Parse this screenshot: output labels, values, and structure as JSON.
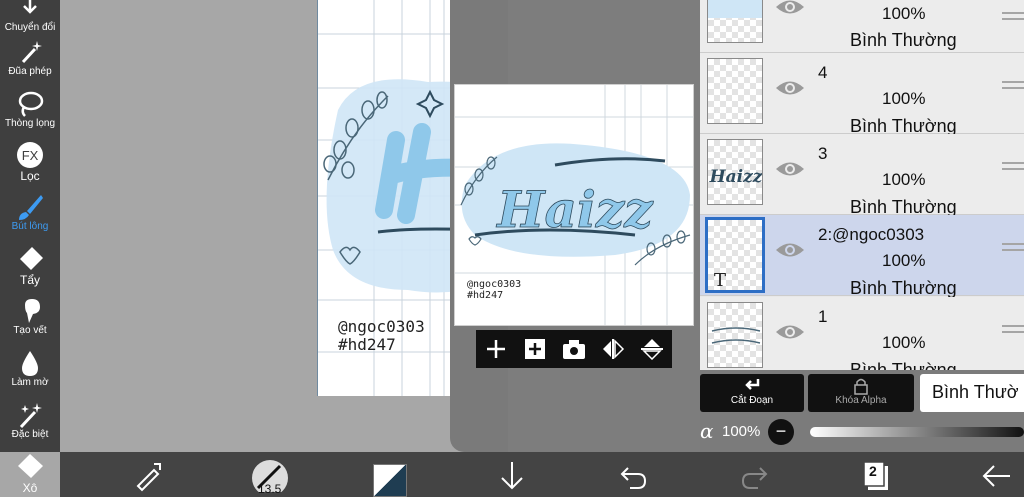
{
  "tools": [
    {
      "id": "transform",
      "label": "Chuyển đổi",
      "icon": "move-arrows-icon"
    },
    {
      "id": "magic-wand",
      "label": "Đũa phép",
      "icon": "magic-wand-icon"
    },
    {
      "id": "lasso",
      "label": "Thòng lọng",
      "icon": "lasso-icon"
    },
    {
      "id": "filter",
      "label": "Lọc",
      "icon": "fx-icon",
      "glyph": "FX"
    },
    {
      "id": "brush",
      "label": "Bút lông",
      "icon": "brush-icon",
      "active": true
    },
    {
      "id": "eraser",
      "label": "Tẩy",
      "icon": "eraser-icon"
    },
    {
      "id": "smudge",
      "label": "Tạo vết",
      "icon": "smudge-icon"
    },
    {
      "id": "blur",
      "label": "Làm mờ",
      "icon": "blur-drop-icon"
    },
    {
      "id": "special",
      "label": "Đặc biệt",
      "icon": "sparkle-wand-icon"
    },
    {
      "id": "fill",
      "label": "Xô",
      "icon": "bucket-icon"
    }
  ],
  "canvas": {
    "credit_user": "@ngoc0303",
    "credit_tag": "#hd247",
    "artwork_text": "Haizz"
  },
  "reference": {
    "credit_user": "@ngoc0303",
    "credit_tag": "#hd247",
    "artwork_text": "Haizz",
    "buttons": [
      {
        "name": "add-icon",
        "glyph": "+"
      },
      {
        "name": "add-layer-icon",
        "glyph": "+"
      },
      {
        "name": "camera-icon",
        "glyph": ""
      },
      {
        "name": "flip-horizontal-icon",
        "glyph": ""
      },
      {
        "name": "flip-vertical-icon",
        "glyph": ""
      }
    ]
  },
  "layers": [
    {
      "name": "",
      "opacity": "100%",
      "blend": "Bình Thường",
      "selected": false,
      "thumb": "art"
    },
    {
      "name": "4",
      "opacity": "100%",
      "blend": "Bình Thường",
      "selected": false,
      "thumb": "empty"
    },
    {
      "name": "3",
      "opacity": "100%",
      "blend": "Bình Thường",
      "selected": false,
      "thumb": "haizz"
    },
    {
      "name": "2:@ngoc0303",
      "opacity": "100%",
      "blend": "Bình Thường",
      "selected": true,
      "thumb": "text"
    },
    {
      "name": "1",
      "opacity": "100%",
      "blend": "Bình Thường",
      "selected": false,
      "thumb": "lines"
    }
  ],
  "layer_controls": {
    "clipping_label": "Cắt Đoạn",
    "alpha_lock_label": "Khóa Alpha",
    "blend_mode": "Bình Thườ",
    "alpha_symbol": "α",
    "opacity": "100%",
    "opacity_fraction": 1.0
  },
  "bottom": {
    "brush_size": "13.5",
    "layer_count": "2"
  },
  "colors": {
    "toolbar_bg": "#3f3f3f",
    "active_tool": "#3d9bf2",
    "selected_layer": "#cdd6ec",
    "selected_border": "#2d6ec5",
    "art_blue": "#8fc8ea",
    "art_dark": "#2e4b5e"
  }
}
